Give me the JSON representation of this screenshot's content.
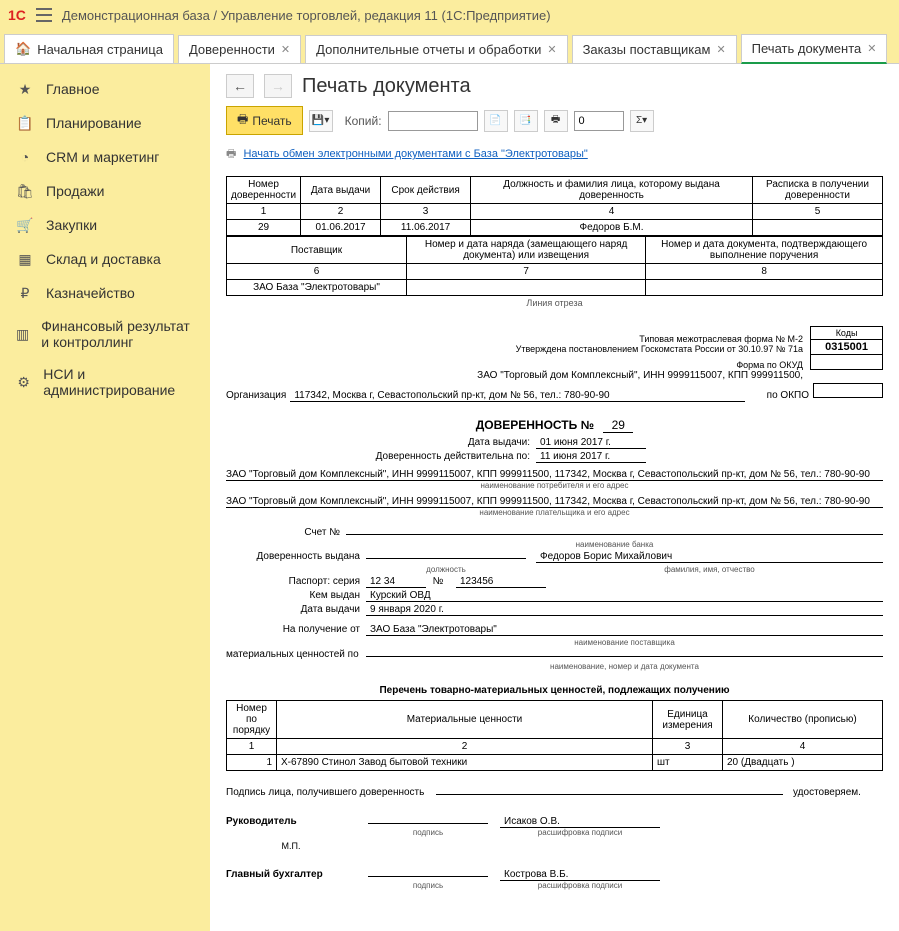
{
  "app": {
    "title": "Демонстрационная база / Управление торговлей, редакция 11  (1С:Предприятие)"
  },
  "tabs": {
    "home": "Начальная страница",
    "items": [
      {
        "label": "Доверенности"
      },
      {
        "label": "Дополнительные отчеты и обработки"
      },
      {
        "label": "Заказы поставщикам"
      },
      {
        "label": "Печать документа",
        "active": true
      }
    ]
  },
  "sidebar": {
    "items": [
      {
        "icon": "star",
        "label": "Главное"
      },
      {
        "icon": "calendar",
        "label": "Планирование"
      },
      {
        "icon": "pie",
        "label": "CRM и маркетинг"
      },
      {
        "icon": "bag",
        "label": "Продажи"
      },
      {
        "icon": "cart",
        "label": "Закупки"
      },
      {
        "icon": "boxes",
        "label": "Склад и доставка"
      },
      {
        "icon": "coin",
        "label": "Казначейство"
      },
      {
        "icon": "bars",
        "label": "Финансовый результат и контроллинг"
      },
      {
        "icon": "gear",
        "label": "НСИ и администрирование"
      }
    ]
  },
  "page": {
    "title": "Печать документа",
    "print_btn": "Печать",
    "copies_label": "Копий:",
    "copies_value": "",
    "sum_value": "0",
    "link": "Начать обмен электронными документами с База \"Электротовары\""
  },
  "hdrTable": {
    "h": [
      "Номер доверенности",
      "Дата выдачи",
      "Срок действия",
      "Должность и фамилия лица, которому выдана доверенность",
      "Расписка в получении доверенности"
    ],
    "n": [
      "1",
      "2",
      "3",
      "4",
      "5"
    ],
    "r": [
      "29",
      "01.06.2017",
      "11.06.2017",
      "Федоров Б.М.",
      ""
    ]
  },
  "hdrTable2": {
    "h": [
      "Поставщик",
      "Номер и дата наряда (замещающего наряд документа) или извещения",
      "Номер и дата документа, подтверждающего выполнение поручения"
    ],
    "n": [
      "6",
      "7",
      "8"
    ],
    "r": [
      "ЗАО База \"Электротовары\"",
      "",
      ""
    ]
  },
  "cutline": "Линия отреза",
  "form": {
    "topright1": "Типовая межотраслевая форма № М-2",
    "topright2": "Утверждена постановлением Госкомстата России от 30.10.97 № 71а",
    "codes_hdr": "Коды",
    "okud_label": "Форма по ОКУД",
    "okud_val": "0315001",
    "okpo_label": "по ОКПО",
    "org_prefix": "ЗАО \"Торговый дом Комплексный\", ИНН 9999115007, КПП 999911500,",
    "org_label": "Организация",
    "org_val": "117342, Москва г, Севастопольский пр-кт, дом № 56, тел.: 780-90-90",
    "title": "ДОВЕРЕННОСТЬ №",
    "number": "29",
    "date_issue_lab": "Дата выдачи:",
    "date_issue_val": "01 июня 2017 г.",
    "valid_until_lab": "Доверенность действительна по:",
    "valid_until_val": "11 июня 2017 г.",
    "consumer": "ЗАО \"Торговый дом Комплексный\", ИНН 9999115007, КПП 999911500, 117342, Москва г, Севастопольский пр-кт, дом № 56, тел.: 780-90-90",
    "consumer_note": "наименование потребителя и его адрес",
    "payer": "ЗАО \"Торговый дом Комплексный\", ИНН 9999115007, КПП 999911500, 117342, Москва г, Севастопольский пр-кт, дом № 56, тел.: 780-90-90",
    "payer_note": "наименование плательщика и его адрес",
    "account_lab": "Счет №",
    "account_note": "наименование банка",
    "issued_lab": "Доверенность выдана",
    "issued_pos_note": "должность",
    "issued_name": "Федоров Борис Михайлович",
    "issued_name_note": "фамилия, имя, отчество",
    "passport_lab": "Паспорт: серия",
    "passport_ser": "12 34",
    "passport_numlab": "№",
    "passport_num": "123456",
    "passport_by_lab": "Кем выдан",
    "passport_by": "Курский ОВД",
    "passport_date_lab": "Дата выдачи",
    "passport_date": "9 января 2020 г.",
    "recv_lab": "На получение от",
    "recv_val": "ЗАО База \"Электротовары\"",
    "recv_note": "наименование поставщика",
    "values_lab": "материальных ценностей по",
    "values_note": "наименование, номер и дата документа"
  },
  "list": {
    "title": "Перечень товарно-материальных ценностей, подлежащих получению",
    "h": [
      "Номер по порядку",
      "Материальные ценности",
      "Единица измерения",
      "Количество (прописью)"
    ],
    "n": [
      "1",
      "2",
      "3",
      "4"
    ],
    "rows": [
      {
        "n": "1",
        "name": "X-67890 Стинол Завод бытовой техники",
        "unit": "шт",
        "qty": "20 (Двадцать )"
      }
    ]
  },
  "sig": {
    "recv_sig_lab": "Подпись лица, получившего доверенность",
    "certify": "удостоверяем.",
    "head_lab": "Руководитель",
    "head_name": "Исаков О.В.",
    "mp": "М.П.",
    "sub_sign": "подпись",
    "sub_dec": "расшифровка подписи",
    "acc_lab": "Главный бухгалтер",
    "acc_name": "Кострова В.Б."
  }
}
